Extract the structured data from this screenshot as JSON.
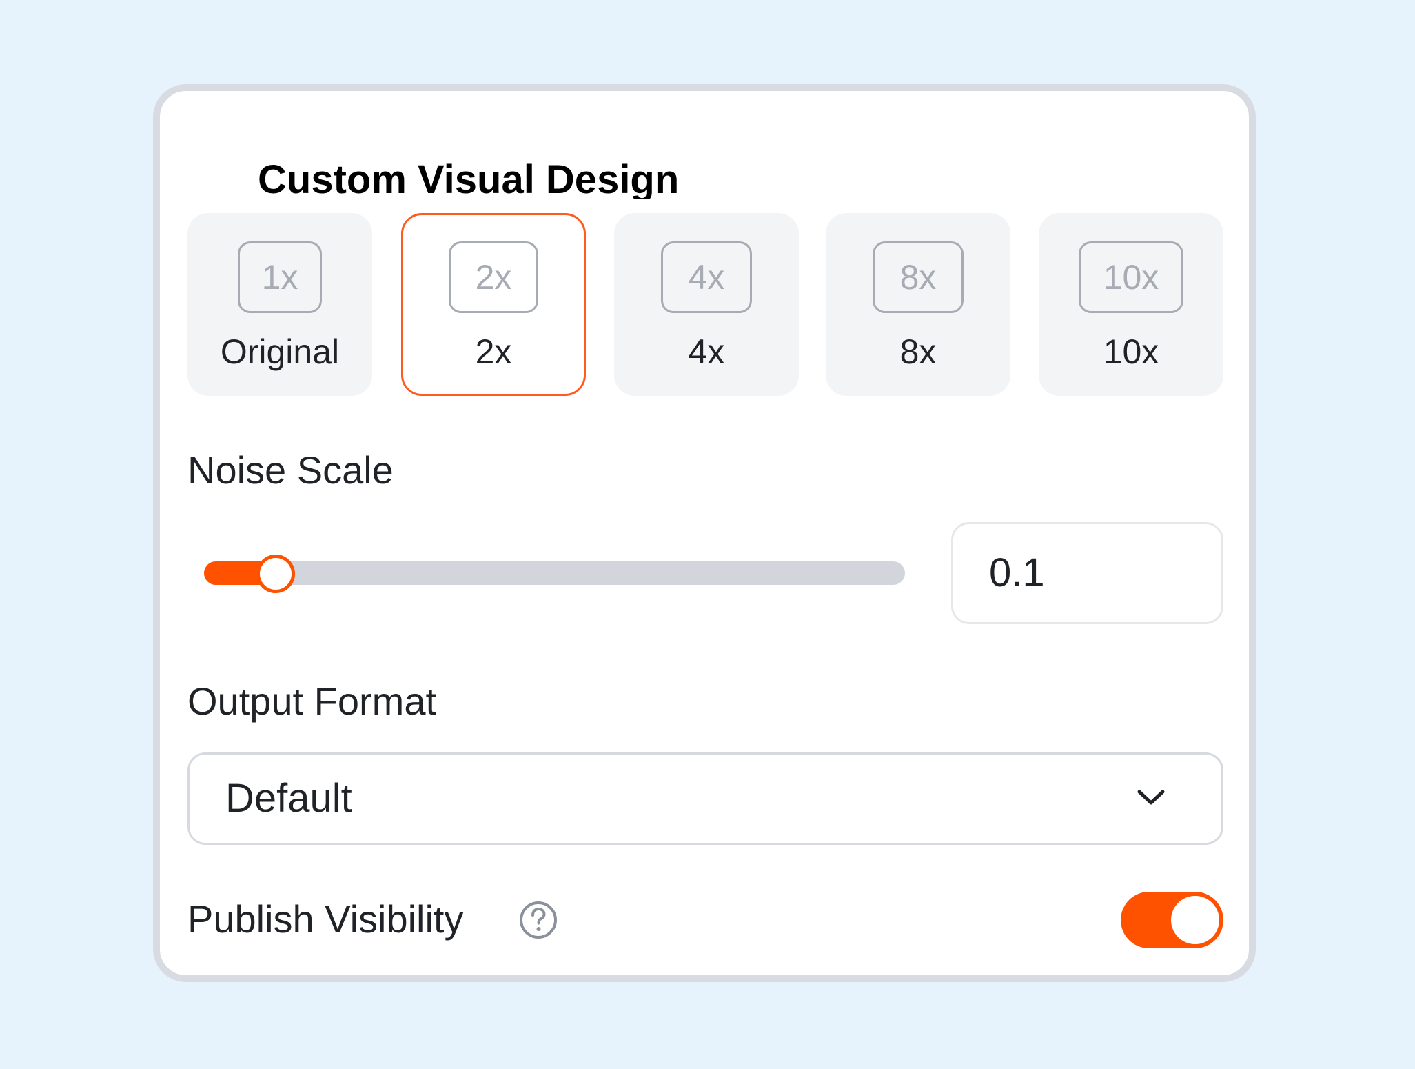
{
  "panel": {
    "title": "Custom Visual Design"
  },
  "upscale": {
    "selected_index": 1,
    "options": [
      {
        "badge": "1x",
        "label": "Original"
      },
      {
        "badge": "2x",
        "label": "2x"
      },
      {
        "badge": "4x",
        "label": "4x"
      },
      {
        "badge": "8x",
        "label": "8x"
      },
      {
        "badge": "10x",
        "label": "10x"
      }
    ]
  },
  "noise_scale": {
    "label": "Noise Scale",
    "value": "0.1",
    "slider_fraction": 0.1
  },
  "output_format": {
    "label": "Output Format",
    "selected": "Default"
  },
  "publish_visibility": {
    "label": "Publish Visibility",
    "enabled": true
  },
  "colors": {
    "accent": "#ff5200",
    "page_background": "#e6f3fd",
    "card_border": "#d8dce2",
    "option_background": "#f3f4f6"
  },
  "icons": {
    "dropdown": "chevron-down-icon",
    "help": "question-circle-icon"
  }
}
